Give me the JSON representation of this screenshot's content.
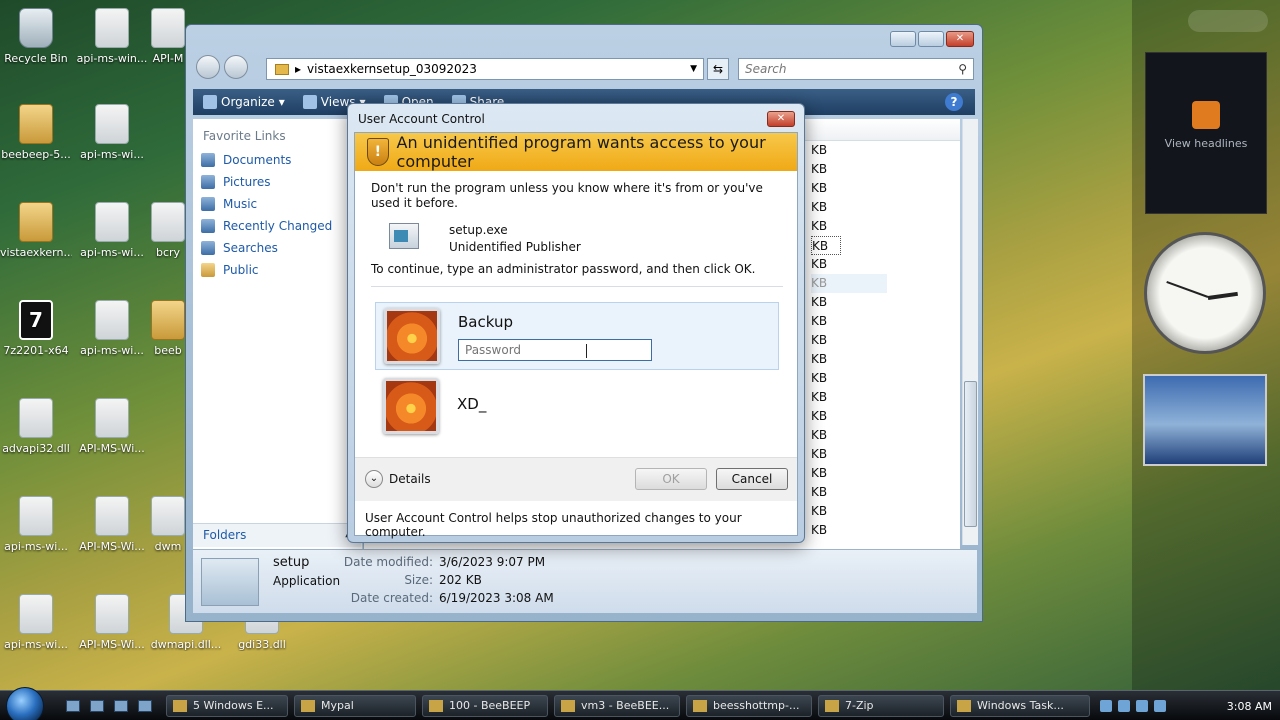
{
  "desktop": {
    "icons": [
      {
        "label": "Recycle Bin",
        "kind": "bin"
      },
      {
        "label": "api-ms-win...",
        "kind": "file"
      },
      {
        "label": "API-M",
        "kind": "file"
      },
      {
        "label": "beebeep-5...",
        "kind": "folder"
      },
      {
        "label": "api-ms-wi...",
        "kind": "file"
      },
      {
        "label": "vistaexkern...",
        "kind": "folder"
      },
      {
        "label": "api-ms-wi...",
        "kind": "file"
      },
      {
        "label": "bcry",
        "kind": "file"
      },
      {
        "label": "7z2201-x64",
        "kind": "zip"
      },
      {
        "label": "api-ms-wi...",
        "kind": "file"
      },
      {
        "label": "beeb",
        "kind": "folder"
      },
      {
        "label": "advapi32.dll",
        "kind": "file"
      },
      {
        "label": "API-MS-Wi...",
        "kind": "file"
      },
      {
        "label": "api-ms-wi...",
        "kind": "file"
      },
      {
        "label": "API-MS-Wi...",
        "kind": "file"
      },
      {
        "label": "dwm",
        "kind": "file"
      },
      {
        "label": "api-ms-wi...",
        "kind": "file"
      },
      {
        "label": "API-MS-Wi...",
        "kind": "file"
      },
      {
        "label": "dwmapi.dll...",
        "kind": "file"
      },
      {
        "label": "gdi33.dll",
        "kind": "file"
      }
    ],
    "gadgets": {
      "rss_label": "View headlines"
    }
  },
  "explorer": {
    "address_path": "vistaexkernsetup_03092023",
    "search_placeholder": "Search",
    "toolbar": {
      "organize": "Organize",
      "views": "Views",
      "open": "Open",
      "share": "Share"
    },
    "favorite_links_label": "Favorite Links",
    "favorites": [
      "Documents",
      "Pictures",
      "Music",
      "Recently Changed",
      "Searches",
      "Public"
    ],
    "folders_label": "Folders",
    "size_unit": "KB",
    "details": {
      "name": "setup",
      "type": "Application",
      "date_modified_label": "Date modified:",
      "date_modified": "3/6/2023 9:07 PM",
      "size_label": "Size:",
      "size": "202 KB",
      "date_created_label": "Date created:",
      "date_created": "6/19/2023 3:08 AM"
    }
  },
  "uac": {
    "title": "User Account Control",
    "header": "An unidentified program wants access to your computer",
    "warning": "Don't run the program unless you know where it's from or you've used it before.",
    "program_name": "setup.exe",
    "publisher": "Unidentified Publisher",
    "instruction": "To continue, type an administrator password, and then click OK.",
    "accounts": [
      {
        "name": "Backup",
        "password_placeholder": "Password",
        "selected": true
      },
      {
        "name": "XD_",
        "selected": false
      }
    ],
    "details_label": "Details",
    "ok_label": "OK",
    "cancel_label": "Cancel",
    "footer_text": "User Account Control helps stop unauthorized changes to your computer."
  },
  "taskbar": {
    "buttons": [
      "5 Windows E...",
      "Mypal",
      "100 - BeeBEEP",
      "vm3 - BeeBEE...",
      "beesshottmp-...",
      "7-Zip",
      "Windows Task..."
    ],
    "clock": "3:08 AM"
  }
}
